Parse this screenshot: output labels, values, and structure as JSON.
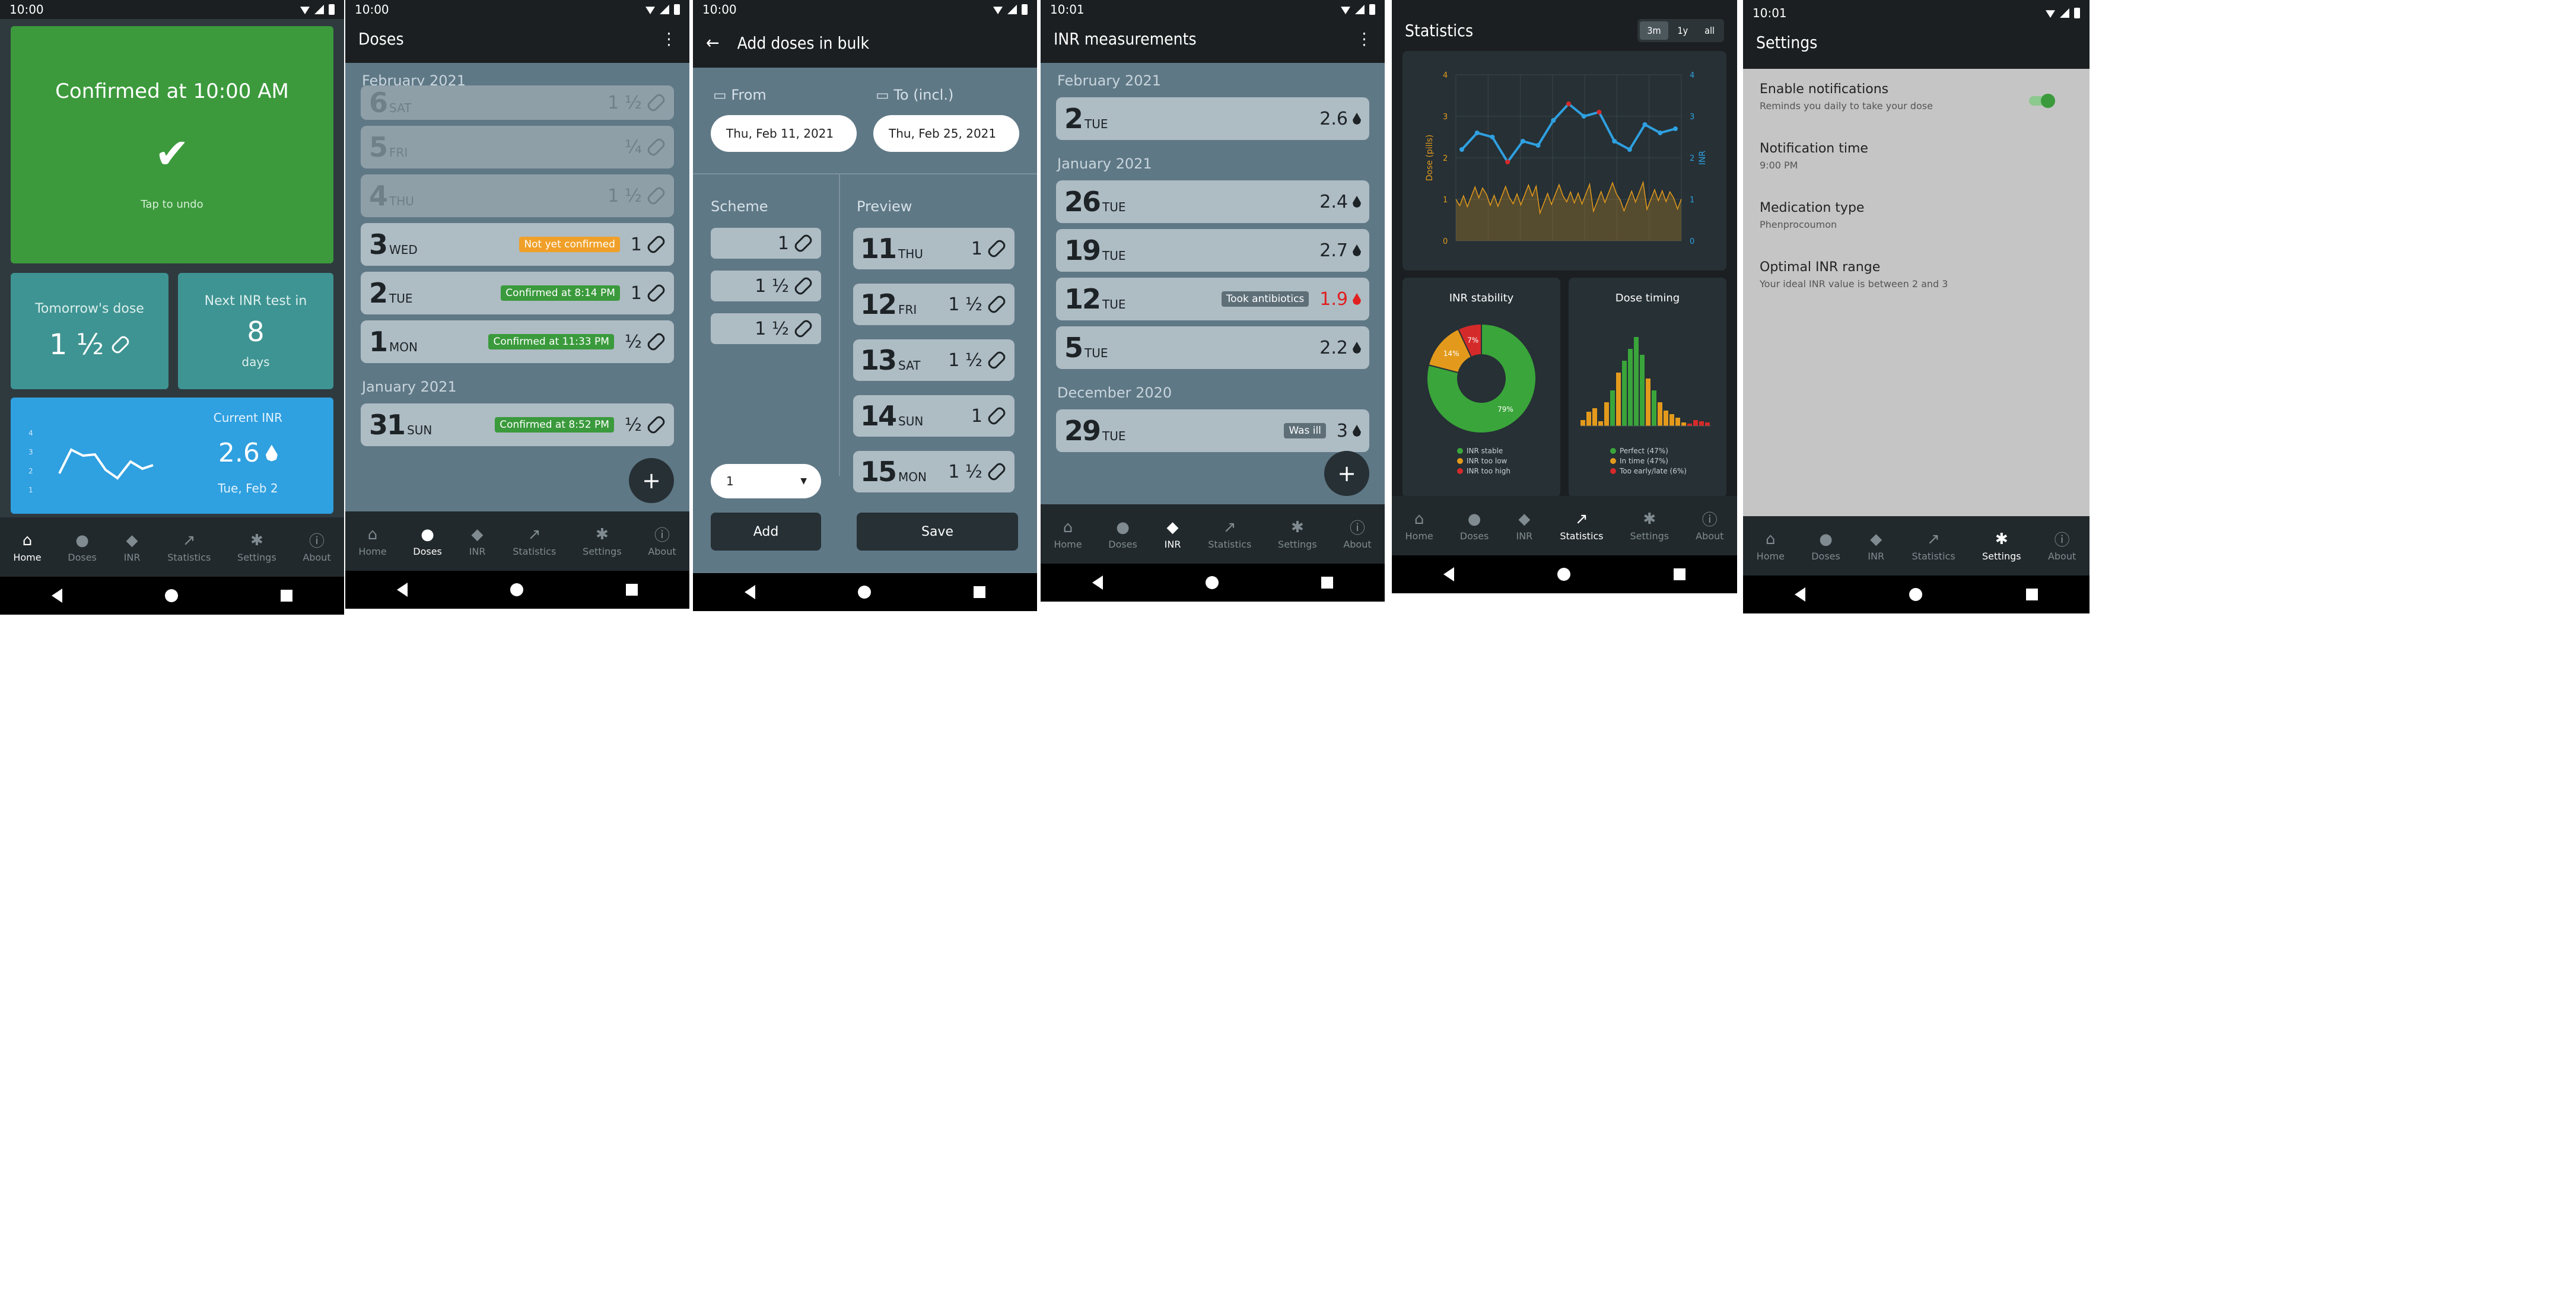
{
  "status": {
    "time1": "10:00",
    "time2": "10:00",
    "time3": "10:00",
    "time4": "10:01",
    "time6": "10:01"
  },
  "nav": {
    "home": "Home",
    "doses": "Doses",
    "inr": "INR",
    "statistics": "Statistics",
    "settings": "Settings",
    "about": "About"
  },
  "home": {
    "confirmed_title": "Confirmed at 10:00 AM",
    "tap_undo": "Tap to undo",
    "tomorrow_label": "Tomorrow's dose",
    "tomorrow_value": "1 ½",
    "next_inr_label": "Next INR test in",
    "next_inr_value": "8",
    "next_inr_unit": "days",
    "current_inr_label": "Current INR",
    "current_inr_value": "2.6",
    "current_inr_date": "Tue, Feb 2",
    "mini_axis": [
      "4",
      "3",
      "2",
      "1"
    ]
  },
  "doses": {
    "title": "Doses",
    "month_feb": "February 2021",
    "month_jan": "January 2021",
    "rows": [
      {
        "num": "6",
        "day": "SAT",
        "val": "1 ½",
        "badge": ""
      },
      {
        "num": "5",
        "day": "FRI",
        "val": "¼",
        "badge": ""
      },
      {
        "num": "4",
        "day": "THU",
        "val": "1 ½",
        "badge": ""
      },
      {
        "num": "3",
        "day": "WED",
        "val": "1",
        "badge": "Not yet confirmed"
      },
      {
        "num": "2",
        "day": "TUE",
        "val": "1",
        "badge": "Confirmed at 8:14 PM"
      },
      {
        "num": "1",
        "day": "MON",
        "val": "½",
        "badge": "Confirmed at 11:33 PM"
      },
      {
        "num": "31",
        "day": "SUN",
        "val": "½",
        "badge": "Confirmed at 8:52 PM"
      }
    ],
    "fab": "+"
  },
  "bulk": {
    "title": "Add doses in bulk",
    "from_label": "From",
    "to_label": "To (incl.)",
    "from_value": "Thu, Feb 11, 2021",
    "to_value": "Thu, Feb 25, 2021",
    "scheme_label": "Scheme",
    "preview_label": "Preview",
    "scheme": [
      "1",
      "1 ½",
      "1 ½"
    ],
    "preview": [
      {
        "num": "11",
        "day": "THU",
        "val": "1"
      },
      {
        "num": "12",
        "day": "FRI",
        "val": "1 ½"
      },
      {
        "num": "13",
        "day": "SAT",
        "val": "1 ½"
      },
      {
        "num": "14",
        "day": "SUN",
        "val": "1"
      },
      {
        "num": "15",
        "day": "MON",
        "val": "1 ½"
      }
    ],
    "add_select": "1",
    "add_button": "Add",
    "save_button": "Save"
  },
  "inr": {
    "title": "INR measurements",
    "month_feb": "February 2021",
    "month_jan": "January 2021",
    "month_dec": "December 2020",
    "rows": [
      {
        "num": "2",
        "day": "TUE",
        "val": "2.6",
        "badge": ""
      },
      {
        "num": "26",
        "day": "TUE",
        "val": "2.4",
        "badge": ""
      },
      {
        "num": "19",
        "day": "TUE",
        "val": "2.7",
        "badge": ""
      },
      {
        "num": "12",
        "day": "TUE",
        "val": "1.9",
        "badge": "Took antibiotics"
      },
      {
        "num": "5",
        "day": "TUE",
        "val": "2.2",
        "badge": ""
      },
      {
        "num": "29",
        "day": "TUE",
        "val": "3",
        "badge": "Was ill"
      }
    ],
    "fab": "+"
  },
  "stats": {
    "title": "Statistics",
    "ranges": [
      "3m",
      "1y",
      "all"
    ],
    "left_axis_label": "Dose (pills)",
    "right_axis_label": "INR",
    "left_ticks": [
      "4",
      "3",
      "2",
      "1",
      "0"
    ],
    "right_ticks": [
      "4",
      "3",
      "2",
      "1",
      "0"
    ],
    "stability_title": "INR stability",
    "timing_title": "Dose timing",
    "pie_labels": [
      "79%",
      "14%",
      "7%"
    ],
    "stability_legend": [
      "INR stable",
      "INR too low",
      "INR too high"
    ],
    "timing_legend": [
      "Perfect (47%)",
      "In time (47%)",
      "Too early/late (6%)"
    ]
  },
  "settings": {
    "title": "Settings",
    "items": [
      {
        "title": "Enable notifications",
        "sub": "Reminds you daily to take your dose"
      },
      {
        "title": "Notification time",
        "sub": "9:00 PM"
      },
      {
        "title": "Medication type",
        "sub": "Phenprocoumon"
      },
      {
        "title": "Optimal INR range",
        "sub": "Your ideal INR value is between 2 and 3"
      }
    ]
  },
  "chart_data": [
    {
      "type": "line",
      "title": "",
      "xlabel": "",
      "ylabel": "INR",
      "ylim": [
        0,
        4
      ],
      "series": [
        {
          "values": [
            2.2,
            2.6,
            2.5,
            1.9,
            2.4,
            2.3,
            2.9,
            3.3,
            3.0,
            3.1,
            2.4,
            2.2,
            2.8,
            2.6,
            2.7
          ]
        }
      ]
    },
    {
      "type": "pie",
      "title": "INR stability",
      "categories": [
        "INR stable",
        "INR too low",
        "INR too high"
      ],
      "values": [
        79,
        14,
        7
      ]
    }
  ]
}
